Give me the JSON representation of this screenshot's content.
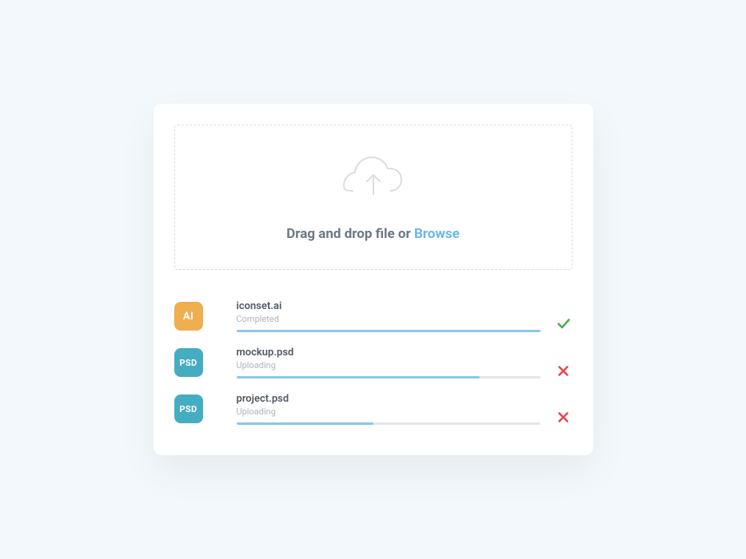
{
  "dropzone": {
    "prompt_prefix": "Drag and drop file or ",
    "browse_label": "Browse"
  },
  "files": [
    {
      "badge": "AI",
      "badge_class": "ai",
      "name": "iconset.ai",
      "status": "Completed",
      "progress": 100,
      "action": "check"
    },
    {
      "badge": "PSD",
      "badge_class": "psd",
      "name": "mockup.psd",
      "status": "Uploading",
      "progress": 80,
      "action": "cancel"
    },
    {
      "badge": "PSD",
      "badge_class": "psd",
      "name": "project.psd",
      "status": "Uploading",
      "progress": 45,
      "action": "cancel"
    }
  ],
  "colors": {
    "accent": "#8bc7ea",
    "success": "#4caf50",
    "danger": "#e24b4b",
    "text": "#6d7784"
  }
}
